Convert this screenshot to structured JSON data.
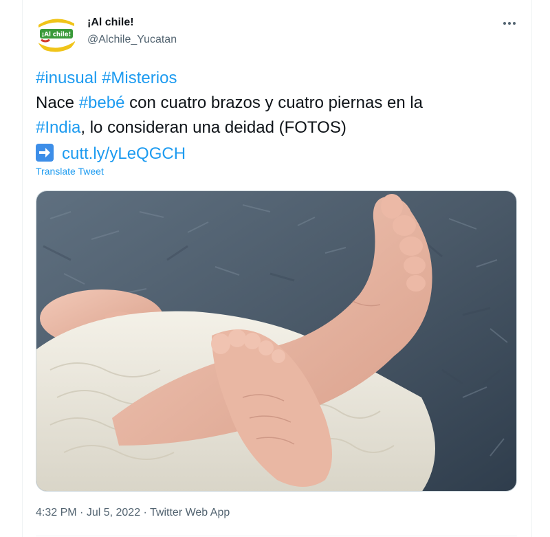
{
  "author": {
    "display_name": "¡Al chile!",
    "handle": "@Alchile_Yucatan",
    "avatar_text": "¡Al chile!"
  },
  "tweet": {
    "hashtag_inusual": "#inusual",
    "hashtag_misterios": "#Misterios",
    "text_1": "Nace ",
    "hashtag_bebe": "#bebé",
    "text_2": " con cuatro brazos y cuatro piernas en la",
    "hashtag_india": "#India",
    "text_3": ", lo consideran una deidad (FOTOS)",
    "link": "cutt.ly/yLeQGCH",
    "arrow_icon": "right-arrow-emoji-icon",
    "translate_label": "Translate Tweet"
  },
  "meta": {
    "time": "4:32 PM",
    "date": "Jul 5, 2022",
    "source": "Twitter Web App",
    "separator": " · "
  },
  "colors": {
    "link": "#1d9bf0",
    "text": "#0f1419",
    "secondary": "#536471",
    "arrow_box": "#3d8ee8"
  },
  "media": {
    "description_icon": "baby-feet-photo"
  }
}
